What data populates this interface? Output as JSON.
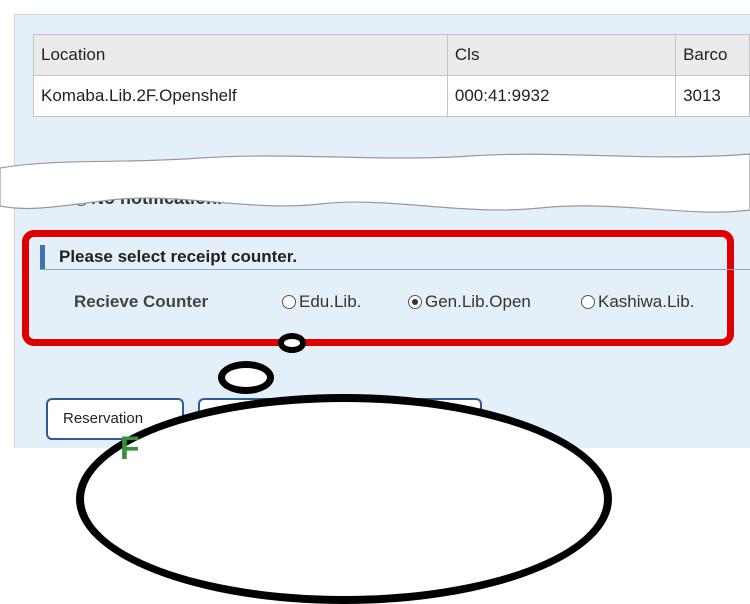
{
  "table": {
    "headers": [
      "Location",
      "Cls",
      "Barco"
    ],
    "rows": [
      [
        "Komaba.Lib.2F.Openshelf",
        "000:41:9932",
        "3013"
      ]
    ]
  },
  "notification": {
    "partial_label": "No notification."
  },
  "receipt": {
    "heading": "Please select receipt counter.",
    "label": "Recieve Counter",
    "options": [
      "Edu.Lib.",
      "Gen.Lib.Open",
      "Kashiwa.Lib."
    ],
    "selected": "Gen.Lib.Open"
  },
  "buttons": {
    "reservation": "Reservation",
    "second": ""
  },
  "callout": {
    "text": "F"
  },
  "colors": {
    "highlight": "#e00000",
    "accent": "#3f74b4",
    "panel": "#e3f0fa"
  }
}
